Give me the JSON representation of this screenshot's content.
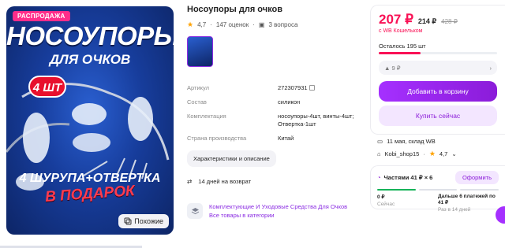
{
  "image": {
    "promo_badge": "РАСПРОДАЖА",
    "title": "НОСОУПОРЫ",
    "subtitle": "ДЛЯ ОЧКОВ",
    "count_badge": "4 ШТ",
    "bottom_line1": "4 ШУРУПА+ОТВЕРТКА",
    "bottom_line2": "В ПОДАРОК",
    "similar_label": "Похожие"
  },
  "product": {
    "title": "Носоупоры для очков",
    "rating": "4,7",
    "reviews": "147 оценок",
    "questions": "3 вопроса"
  },
  "specs": [
    {
      "label": "Артикул",
      "value": "272307931"
    },
    {
      "label": "Состав",
      "value": "силикон"
    },
    {
      "label": "Комплектация",
      "value": "носоупоры-4шт, винты-4шт; Отвертка-1шт"
    },
    {
      "label": "Страна производства",
      "value": "Китай"
    }
  ],
  "chars_button": "Характеристики и описание",
  "return_text": "14 дней на возврат",
  "category": {
    "name": "Комплектующие И Уходовые Средства Для Очков",
    "link": "Все товары в категории"
  },
  "buy": {
    "price": "207 ₽",
    "price_old": "214 ₽",
    "price_strike": "428 ₽",
    "wallet": "с WB Кошельком",
    "stock": "Осталось 195 шт",
    "stock_fraction": 0.35,
    "points": "9 ₽",
    "cart_button": "Добавить в корзину",
    "buy_now_button": "Купить сейчас"
  },
  "delivery": {
    "date": "11 мая, склад WB",
    "seller": "Kobi_shop15",
    "seller_rating": "4,7"
  },
  "installment": {
    "title": "Частями 41 ₽ × 6",
    "button": "Оформить",
    "now_value": "0 ₽",
    "now_label": "Сейчас",
    "later_value": "Дальше 6 платежей по 41 ₽",
    "later_label": "Раз в 14 дней"
  },
  "colors": {
    "accent": "#8b1cd9",
    "price": "#f91155",
    "rating_star": "#ffa200"
  }
}
